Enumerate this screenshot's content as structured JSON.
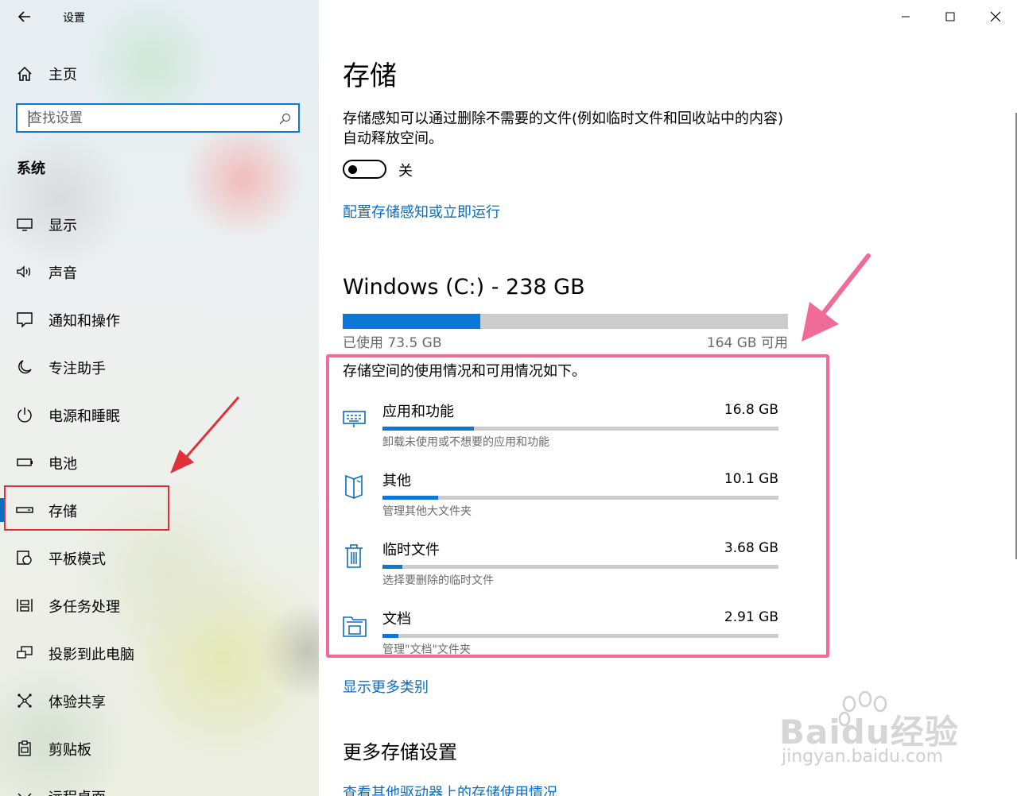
{
  "window": {
    "title": "设置"
  },
  "sidebar": {
    "home_label": "主页",
    "search_placeholder": "查找设置",
    "section": "系统",
    "items": [
      {
        "label": "显示",
        "icon": "monitor-icon"
      },
      {
        "label": "声音",
        "icon": "speaker-icon"
      },
      {
        "label": "通知和操作",
        "icon": "notification-icon"
      },
      {
        "label": "专注助手",
        "icon": "moon-icon"
      },
      {
        "label": "电源和睡眠",
        "icon": "power-icon"
      },
      {
        "label": "电池",
        "icon": "battery-icon"
      },
      {
        "label": "存储",
        "icon": "storage-icon",
        "selected": true
      },
      {
        "label": "平板模式",
        "icon": "tablet-mode-icon"
      },
      {
        "label": "多任务处理",
        "icon": "multitasking-icon"
      },
      {
        "label": "投影到此电脑",
        "icon": "project-icon"
      },
      {
        "label": "体验共享",
        "icon": "share-icon"
      },
      {
        "label": "剪贴板",
        "icon": "clipboard-icon"
      },
      {
        "label": "远程桌面",
        "icon": "remote-desktop-icon"
      }
    ]
  },
  "main": {
    "title": "存储",
    "storage_sense_desc": "存储感知可以通过删除不需要的文件(例如临时文件和回收站中的内容)自动释放空间。",
    "toggle_state": "关",
    "configure_link": "配置存储感知或立即运行",
    "drive": {
      "title": "Windows (C:) - 238 GB",
      "used": "已使用 73.5 GB",
      "free": "164 GB 可用",
      "used_fraction": 0.309
    },
    "usage_heading": "存储空间的使用情况和可用情况如下。",
    "categories": [
      {
        "name": "应用和功能",
        "size": "16.8 GB",
        "desc": "卸载未使用或不想要的应用和功能",
        "fraction": 0.23,
        "icon": "apps-keyboard-icon"
      },
      {
        "name": "其他",
        "size": "10.1 GB",
        "desc": "管理其他大文件夹",
        "fraction": 0.14,
        "icon": "other-files-icon"
      },
      {
        "name": "临时文件",
        "size": "3.68 GB",
        "desc": "选择要删除的临时文件",
        "fraction": 0.05,
        "icon": "trash-icon"
      },
      {
        "name": "文档",
        "size": "2.91 GB",
        "desc": "管理\"文档\"文件夹",
        "fraction": 0.04,
        "icon": "documents-folder-icon"
      }
    ],
    "show_more_link": "显示更多类别",
    "more_settings_title": "更多存储设置",
    "other_drives_link": "查看其他驱动器上的存储使用情况"
  },
  "watermark": {
    "brand": "Baidu经验",
    "url": "jingyan.baidu.com"
  },
  "colors": {
    "accent": "#0b78d7",
    "link": "#0b6cc1",
    "highlight_pink": "#f06b97",
    "highlight_red": "#e0303a"
  }
}
